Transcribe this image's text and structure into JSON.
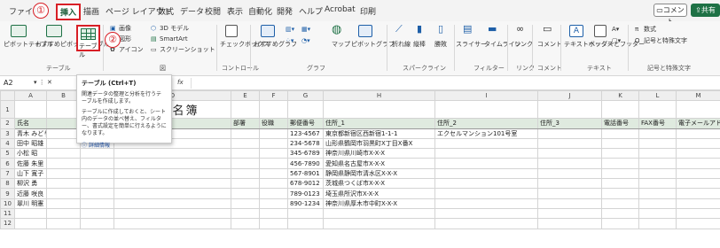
{
  "menu": {
    "tabs": [
      "ファイル",
      "挿入",
      "描画",
      "ページ レイアウト",
      "数式",
      "データ",
      "校閲",
      "表示",
      "自動化",
      "開発",
      "ヘルプ",
      "Acrobat",
      "印刷"
    ],
    "active_tab": "挿入",
    "comment_label": "コメント",
    "share_label": "共有"
  },
  "ribbon": {
    "pivot_label": "ピボットテーブル",
    "recommended_pivot_label": "おすすめピボットテーブル",
    "table_label": "テーブル",
    "illustrations": {
      "image": "画像",
      "shapes": "図形",
      "icons": "アイコン",
      "model3d": "3D モデル",
      "smartart": "SmartArt",
      "screenshot": "スクリーンショット"
    },
    "checkbox_label": "チェックボックス",
    "recommended_chart_label": "おすすめグラフ",
    "map_label": "マップ",
    "pivot_chart_label": "ピボットグラフ",
    "sparklines": [
      "折れ線",
      "縦棒",
      "勝敗"
    ],
    "slicer_label": "スライサー",
    "timeline_label": "タイムライン",
    "link_label": "リンク",
    "comment_label": "コメント",
    "textbox_label": "テキストボックス",
    "header_footer_label": "ヘッダーとフッター",
    "equation_label": "数式",
    "symbol_label": "記号と特殊文字",
    "groups": {
      "table": "テーブル",
      "illustrations": "図",
      "controls": "コントロール",
      "charts": "グラフ",
      "sparklines": "スパークライン",
      "filter": "フィルター",
      "link": "リンク",
      "comment": "コメント",
      "text": "テキスト",
      "symbols": "記号と特殊文字"
    }
  },
  "callouts": [
    "①",
    "②"
  ],
  "formula_bar": {
    "name_box": "A2",
    "fx": "fx"
  },
  "tooltip": {
    "title": "テーブル (Ctrl+T)",
    "desc1": "関連データの整理と分析を行うテーブルを作成します。",
    "desc2": "テーブルに作成しておくと、シート内のデータの並べ替え、フィルター、書式設定を簡単に行えるようになります。",
    "link": "詳細情報"
  },
  "sheet": {
    "columns": [
      "A",
      "B",
      "C",
      "D",
      "E",
      "F",
      "G",
      "H",
      "I",
      "J",
      "K",
      "L",
      "M"
    ],
    "rows": [
      "1",
      "2",
      "3",
      "4",
      "5",
      "6",
      "7",
      "8",
      "9",
      "10",
      "11",
      "12"
    ],
    "title": "顧客名簿",
    "header": [
      "氏名",
      "",
      "",
      "社",
      "部署",
      "役職",
      "郵便番号",
      "住所_1",
      "住所_2",
      "住所_3",
      "電話番号",
      "FAX番号",
      "電子メールアドレス"
    ],
    "data": [
      [
        "青木 みどり",
        "",
        "",
        "",
        "",
        "",
        "123-4567",
        "東京都新宿区西新宿1-1-1",
        "エクセルマンション101号室",
        "",
        "",
        "",
        ""
      ],
      [
        "田中 昭雄",
        "",
        "",
        "",
        "",
        "",
        "234-5678",
        "山形県鶴岡市羽黒町X丁目X番X",
        "",
        "",
        "",
        "",
        ""
      ],
      [
        "小松 昭",
        "",
        "",
        "",
        "",
        "",
        "345-6789",
        "神奈川県川崎市X-X-X",
        "",
        "",
        "",
        "",
        ""
      ],
      [
        "佐藤 朱里",
        "",
        "",
        "",
        "",
        "",
        "456-7890",
        "愛知県名古屋市X-X-X",
        "",
        "",
        "",
        "",
        ""
      ],
      [
        "山下 寛子",
        "",
        "",
        "",
        "",
        "",
        "567-8901",
        "静岡県静岡市清水区X-X-X",
        "",
        "",
        "",
        "",
        ""
      ],
      [
        "柳沢 勇",
        "",
        "",
        "",
        "",
        "",
        "678-9012",
        "茨城県つくば市X-X-X",
        "",
        "",
        "",
        "",
        ""
      ],
      [
        "近藤 咲良",
        "",
        "",
        "",
        "",
        "",
        "789-0123",
        "埼玉県所沢市X-X-X",
        "",
        "",
        "",
        "",
        ""
      ],
      [
        "翠川 明憲",
        "",
        "",
        "",
        "",
        "",
        "890-1234",
        "神奈川県厚木市中町X-X-X",
        "",
        "",
        "",
        "",
        ""
      ]
    ]
  },
  "colors": {
    "accent": "#1e7145",
    "callout": "#d81f26",
    "header_fill": "#dfeadf"
  }
}
